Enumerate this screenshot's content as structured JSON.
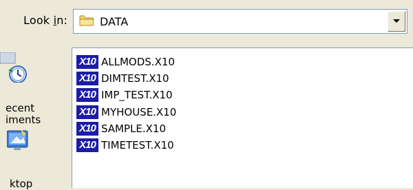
{
  "look_in": {
    "label_prefix": "Look ",
    "label_hotkey": "i",
    "label_suffix": "n:",
    "value": "DATA"
  },
  "places": [
    {
      "label_line1": "ecent",
      "label_line2": "iments",
      "icon": "recent-documents-icon"
    },
    {
      "label_line1": "ktop",
      "icon": "desktop-icon"
    }
  ],
  "files": [
    {
      "icon_text": "X10",
      "name": "ALLMODS.X10"
    },
    {
      "icon_text": "X10",
      "name": "DIMTEST.X10"
    },
    {
      "icon_text": "X10",
      "name": "IMP_TEST.X10"
    },
    {
      "icon_text": "X10",
      "name": "MYHOUSE.X10"
    },
    {
      "icon_text": "X10",
      "name": "SAMPLE.X10"
    },
    {
      "icon_text": "X10",
      "name": "TIMETEST.X10"
    }
  ],
  "colors": {
    "dialog_bg": "#ece9d8",
    "file_icon_bg": "#1c1ca8",
    "border": "#7f9db9"
  }
}
